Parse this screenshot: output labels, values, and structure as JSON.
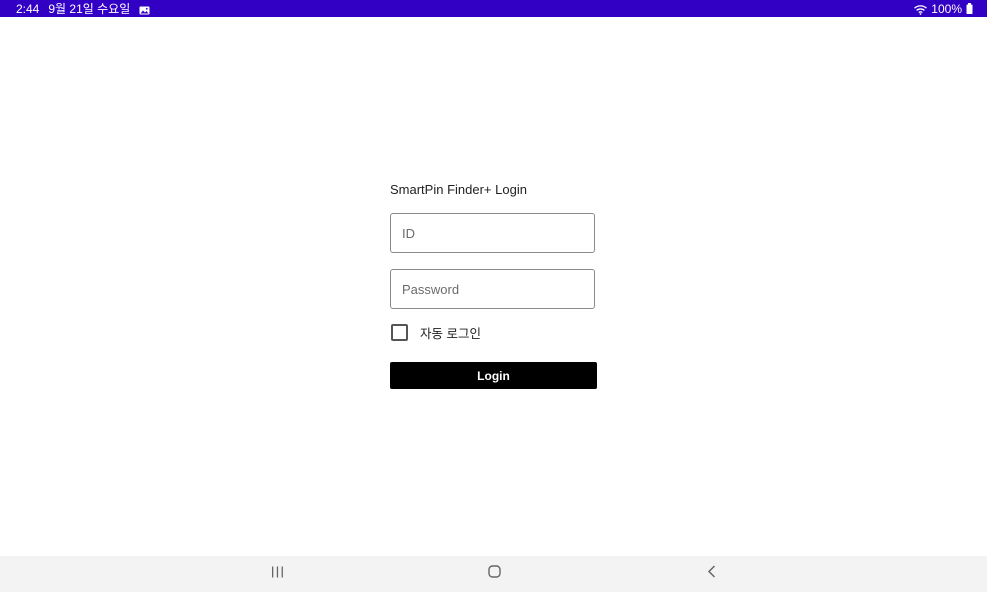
{
  "status_bar": {
    "time": "2:44",
    "date": "9월 21일 수요일",
    "battery": "100%",
    "background_color": "#3100c4",
    "icons": [
      "gallery-icon",
      "wifi-icon",
      "battery-icon"
    ]
  },
  "login": {
    "title": "SmartPin Finder+ Login",
    "id_field": {
      "placeholder": "ID",
      "value": ""
    },
    "password_field": {
      "placeholder": "Password",
      "value": ""
    },
    "auto_login": {
      "label": "자동 로그인",
      "checked": false
    },
    "login_button_label": "Login"
  },
  "nav_bar": {
    "icons": [
      "recents-icon",
      "home-icon",
      "back-icon"
    ]
  }
}
